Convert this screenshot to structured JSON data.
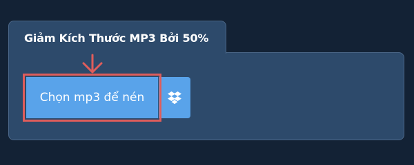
{
  "panel": {
    "title": "Giảm Kích Thước MP3 Bởi 50%"
  },
  "upload": {
    "choose_label": "Chọn mp3 để nén",
    "dropbox_icon": "dropbox-icon"
  },
  "annotation": {
    "arrow_color": "#df5d5b",
    "highlight_color": "#df5d5b"
  },
  "colors": {
    "background": "#132235",
    "panel": "#2d4a6b",
    "button": "#59a3ea"
  }
}
